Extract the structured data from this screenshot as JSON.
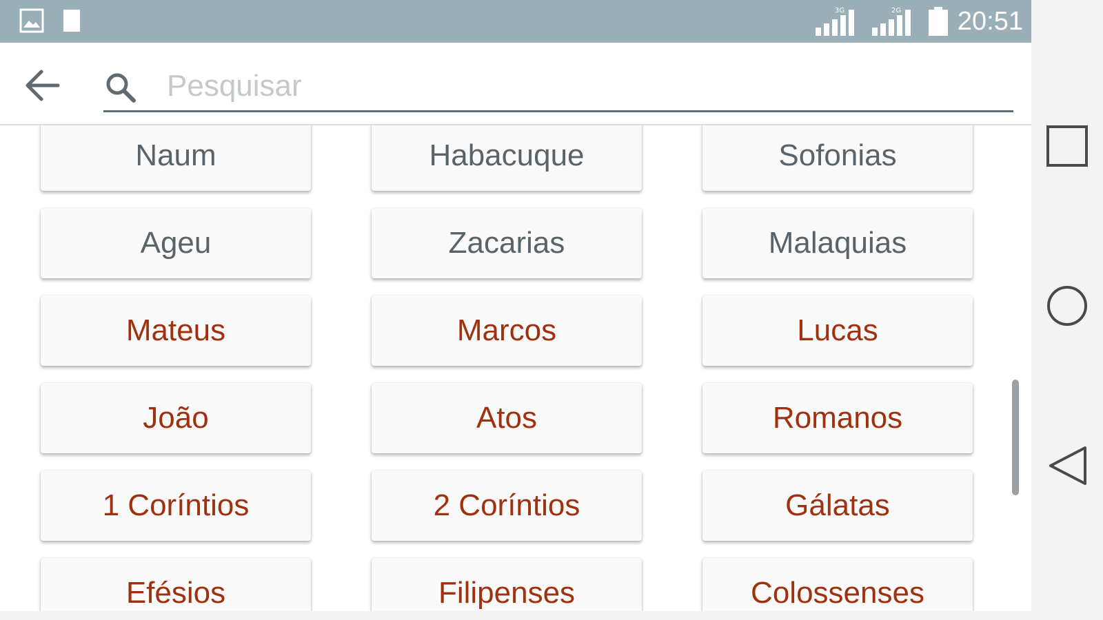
{
  "status_bar": {
    "time": "20:51",
    "left_icons": [
      "image-icon",
      "sd-card-icon"
    ],
    "right_icons": [
      "signal-3g-icon",
      "signal-2g-icon",
      "battery-icon"
    ],
    "background": "#9aafb7"
  },
  "toolbar": {
    "search_placeholder": "Pesquisar",
    "search_value": ""
  },
  "books": {
    "row0": [
      "Naum",
      "Habacuque",
      "Sofonias"
    ],
    "row1": [
      "Ageu",
      "Zacarias",
      "Malaquias"
    ],
    "row2": [
      "Mateus",
      "Marcos",
      "Lucas"
    ],
    "row3": [
      "João",
      "Atos",
      "Romanos"
    ],
    "row4": [
      "1 Coríntios",
      "2 Coríntios",
      "Gálatas"
    ],
    "row5": [
      "Efésios",
      "Filipenses",
      "Colossenses"
    ]
  },
  "colors": {
    "old_testament_text": "#59646a",
    "new_testament_text": "#a0300e",
    "button_background": "#fafafa"
  },
  "nav_bar": {
    "buttons": [
      "recents-square-icon",
      "home-circle-icon",
      "back-triangle-icon"
    ]
  }
}
